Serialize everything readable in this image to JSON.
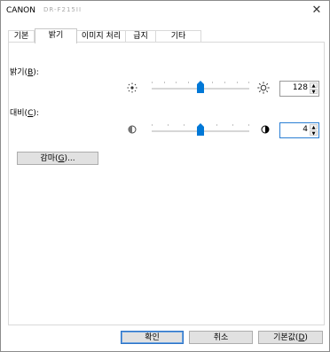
{
  "window": {
    "title": "CANON",
    "model": "DR-F215II",
    "close_glyph": "✕"
  },
  "tabs": [
    {
      "label": "기본",
      "active": false
    },
    {
      "label": "밝기",
      "active": true
    },
    {
      "label": "이미지 처리",
      "active": false
    },
    {
      "label": "급지",
      "active": false
    },
    {
      "label": "기타",
      "active": false
    }
  ],
  "brightness": {
    "label_prefix": "밝기(",
    "mnemonic": "B",
    "label_suffix": "):",
    "value": "128",
    "min": 1,
    "max": 255,
    "icon_low": "sun-small-icon",
    "icon_high": "sun-large-icon"
  },
  "contrast": {
    "label_prefix": "대비(",
    "mnemonic": "C",
    "label_suffix": "):",
    "value": "4",
    "min": 1,
    "max": 7,
    "icon_low": "half-circle-low-icon",
    "icon_high": "half-circle-high-icon"
  },
  "gamma_button": {
    "label_prefix": "감마(",
    "mnemonic": "G",
    "label_suffix": ")..."
  },
  "footer": {
    "ok": "확인",
    "cancel": "취소",
    "default_prefix": "기본값(",
    "default_mnemonic": "D",
    "default_suffix": ")"
  },
  "colors": {
    "accent": "#0078d7",
    "focus_border": "#2a7fd4"
  }
}
